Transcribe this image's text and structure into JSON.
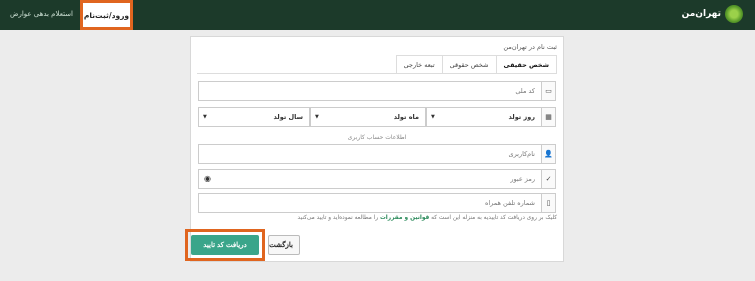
{
  "header": {
    "brand": "تهران‌من",
    "login_tab": "ورود/ثبت‌نام",
    "inquiry_link": "استعلام بدهی عوارض"
  },
  "panel": {
    "title": "ثبت نام در تهران‌من",
    "tabs": [
      {
        "label": "شخص حقیقی",
        "active": true
      },
      {
        "label": "شخص حقوقی",
        "active": false
      },
      {
        "label": "تبعه خارجی",
        "active": false
      }
    ],
    "national_code_placeholder": "کد ملی",
    "birth": {
      "day_label": "روز تولد",
      "month_label": "ماه تولد",
      "year_label": "سال تولد"
    },
    "account_caption": "اطلاعات حساب کاربری",
    "username_placeholder": "نام‌کاربری",
    "password_placeholder": "رمز عبور",
    "mobile_placeholder": "شماره تلفن همراه",
    "terms_prefix": "کلیک بر روی دریافت کد تاییدیه به منزله این است که",
    "terms_link": "قوانین و مقررات",
    "terms_suffix": "را مطالعه نموده‌اید و تایید می‌کنید",
    "confirm_button": "دریافت کد تایید",
    "back_button": "بازگشت"
  },
  "colors": {
    "topbar": "#1c3a2a",
    "accent": "#3aa58a",
    "highlight": "#e0651f"
  }
}
